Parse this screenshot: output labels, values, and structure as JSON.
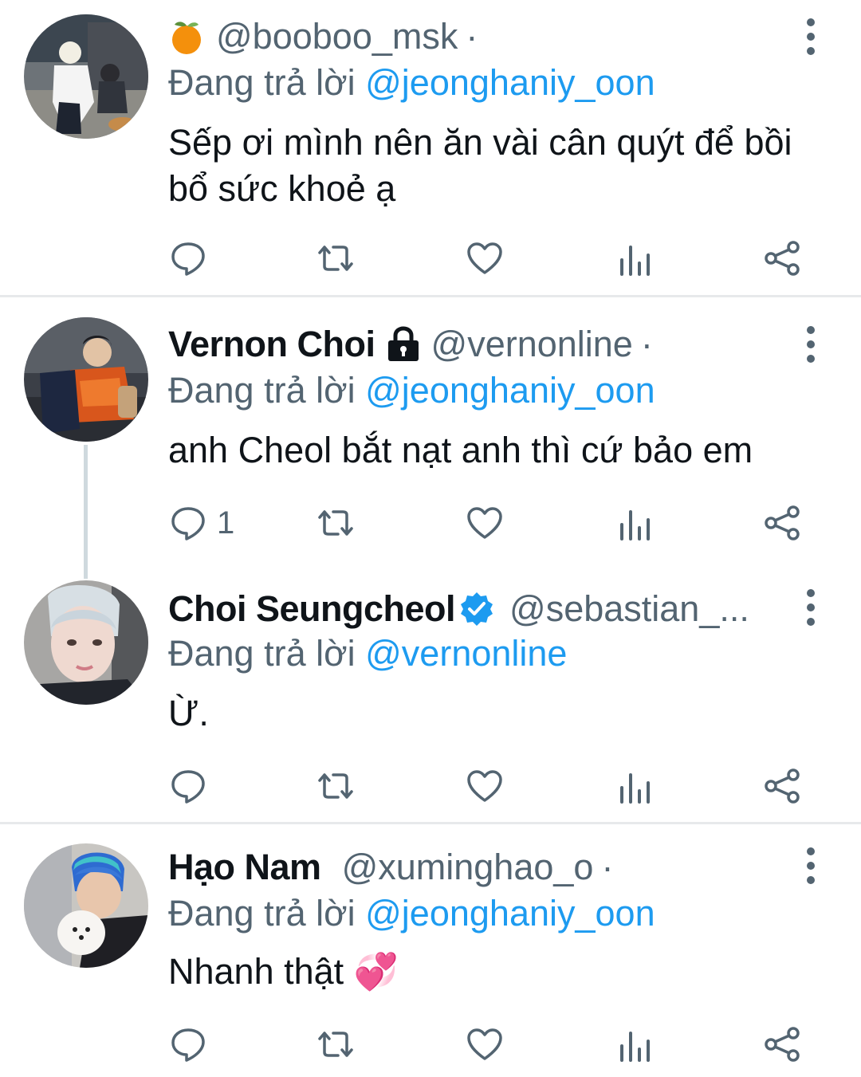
{
  "tweets": [
    {
      "prefix_emoji": "tangerine",
      "name": "",
      "handle": "@booboo_msk",
      "dot": "·",
      "reply_prefix": "Đang trả lời",
      "reply_to": "@jeonghaniy_oon",
      "text": "Sếp ơi mình nên ăn vài cân quýt để bồi bổ sức khoẻ ạ",
      "reply_count": ""
    },
    {
      "name": "Vernon Choi",
      "badge": "lock-icon",
      "handle": "@vernonline",
      "dot": "·",
      "reply_prefix": "Đang trả lời",
      "reply_to": "@jeonghaniy_oon",
      "text": "anh Cheol bắt nạt anh thì cứ bảo em",
      "reply_count": "1"
    },
    {
      "name": "Choi Seungcheol",
      "badge": "verified-icon",
      "handle": "@sebastian_...",
      "reply_prefix": "Đang trả lời",
      "reply_to": "@vernonline",
      "text": "Ừ.",
      "reply_count": ""
    },
    {
      "name": "Hạo Nam",
      "handle": "@xuminghao_o",
      "dot": "·",
      "reply_prefix": "Đang trả lời",
      "reply_to": "@jeonghaniy_oon",
      "text": "Nhanh thật 💞",
      "reply_count": ""
    }
  ],
  "colors": {
    "link": "#1d9bf0",
    "secondary_text": "#536471",
    "primary_text": "#0f1419",
    "divider": "#e7e9eb",
    "thread_line": "#cfd9de"
  }
}
